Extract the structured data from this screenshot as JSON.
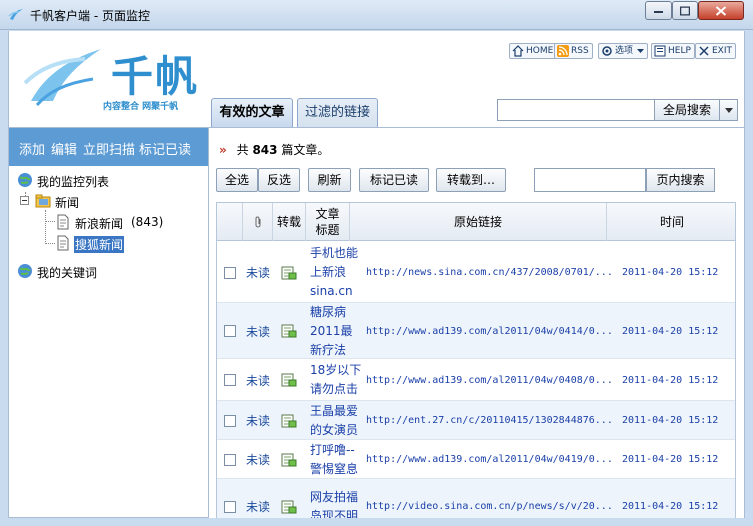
{
  "window": {
    "title": "千帆客户端 - 页面监控",
    "colors": {
      "titlebar": "#c4d7ec",
      "accent": "#5c9bd3",
      "link": "#1a3fa8"
    }
  },
  "header": {
    "brand": "千帆",
    "slogan": "内容整合 网聚千帆",
    "links": [
      {
        "label": "HOME",
        "icon": "home-icon"
      },
      {
        "label": "RSS",
        "icon": "rss-icon"
      },
      {
        "label": "选项",
        "icon": "options-icon"
      },
      {
        "label": "HELP",
        "icon": "help-icon"
      },
      {
        "label": "EXIT",
        "icon": "exit-icon"
      }
    ],
    "tabs": [
      {
        "label": "有效的文章",
        "active": true
      },
      {
        "label": "过滤的链接",
        "active": false
      }
    ],
    "global_search": {
      "button": "全局搜索",
      "value": ""
    }
  },
  "sidebar": {
    "actions": [
      "添加",
      "编辑",
      "立即扫描",
      "标记已读"
    ],
    "tree": {
      "root": "我的监控列表",
      "group": "新闻",
      "feeds": [
        {
          "label": "新浪新闻",
          "count": "(843)"
        },
        {
          "label": "搜狐新闻",
          "count": ""
        }
      ],
      "keywords": "我的关键词"
    }
  },
  "main": {
    "summary": {
      "prefix": "共",
      "count": "843",
      "suffix": "篇文章。"
    },
    "buttons": [
      "全选",
      "反选",
      "刷新",
      "标记已读",
      "转载到…"
    ],
    "page_search": {
      "button": "页内搜索",
      "value": ""
    },
    "table": {
      "headers": {
        "reprint": "转载",
        "title": "文章标题",
        "url": "原始链接",
        "time": "时间"
      },
      "rows": [
        {
          "status": "未读",
          "title": "手机也能上新浪sina.cn",
          "url": "http://news.sina.com.cn/437/2008/0701/...",
          "time": "2011-04-20 15:12"
        },
        {
          "status": "未读",
          "title": "糖尿病2011最新疗法",
          "url": "http://www.ad139.com/al2011/04w/0414/0...",
          "time": "2011-04-20 15:12"
        },
        {
          "status": "未读",
          "title": "18岁以下请勿点击",
          "url": "http://www.ad139.com/al2011/04w/0408/0...",
          "time": "2011-04-20 15:12"
        },
        {
          "status": "未读",
          "title": "王晶最爱的女演员",
          "url": "http://ent.27.cn/c/20110415/1302844876...",
          "time": "2011-04-20 15:12"
        },
        {
          "status": "未读",
          "title": "打呼噜--警惕窒息",
          "url": "http://www.ad139.com/al2011/04w/0419/0...",
          "time": "2011-04-20 15:12"
        },
        {
          "status": "未读",
          "title": "网友拍福岛现不明",
          "url": "http://video.sina.com.cn/p/news/s/v/20...",
          "time": "2011-04-20 15:12"
        }
      ]
    }
  }
}
